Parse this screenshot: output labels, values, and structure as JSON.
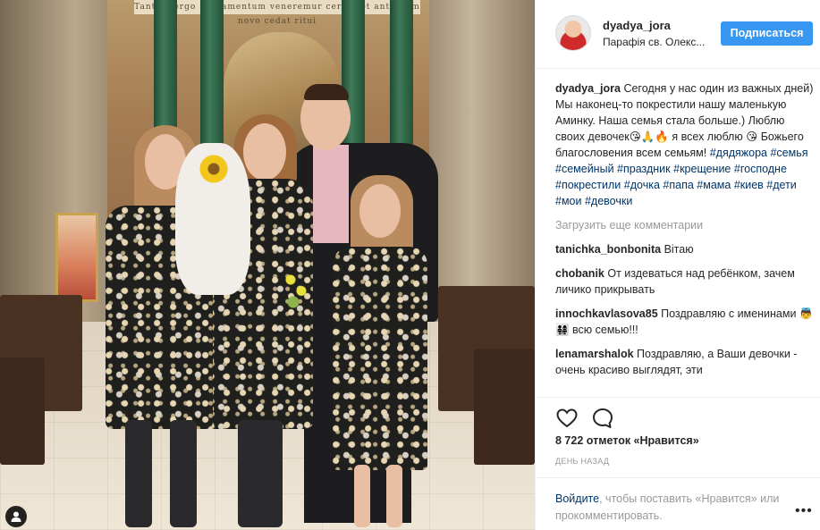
{
  "photo": {
    "banner_text": "Tantum ergo Sacramentum veneremur cernui et antiquum novo cedat ritui"
  },
  "post": {
    "username": "dyadya_jora",
    "location": "Парафія св. Олекс...",
    "follow_label": "Подписаться",
    "caption_user": "dyadya_jora",
    "caption_text": "Сегодня у нас один из важных дней) Мы наконец-то покрестили нашу маленькую Аминку. Наша семья стала больше.) Люблю своих девочек😘🙏🔥 я всех люблю 😘 Божьего благословения всем семьям!",
    "hashtags": [
      "#дядяжора",
      "#семья",
      "#семейный",
      "#праздник",
      "#крещение",
      "#господне",
      "#покрестили",
      "#дочка",
      "#папа",
      "#мама",
      "#киев",
      "#дети",
      "#мои",
      "#девочки"
    ],
    "load_more": "Загрузить еще комментарии",
    "comments": [
      {
        "user": "tanichka_bonbonita",
        "text": "Вітаю"
      },
      {
        "user": "chobanik",
        "text": "От издеваться над ребёнком, зачем личико прикрывать"
      },
      {
        "user": "innochkavlasova85",
        "text": "Поздравляю с именинами 👼👨‍👩‍👧‍👧 всю семью!!!"
      },
      {
        "user": "lenamarshalok",
        "text": "Поздравляю, а Ваши девочки - очень красиво выглядят, эти"
      }
    ],
    "likes": "8 722 отметок «Нравится»",
    "time": "ДЕНЬ НАЗАД",
    "footer_login": "Войдите",
    "footer_rest": ", чтобы поставить «Нравится» или прокомментировать.",
    "more_options": "•••"
  },
  "colors": {
    "accent": "#3897f0",
    "link": "#003569",
    "muted": "#999999"
  },
  "icons": [
    "heart-icon",
    "comment-icon",
    "user-tag-icon",
    "more-options-icon"
  ]
}
